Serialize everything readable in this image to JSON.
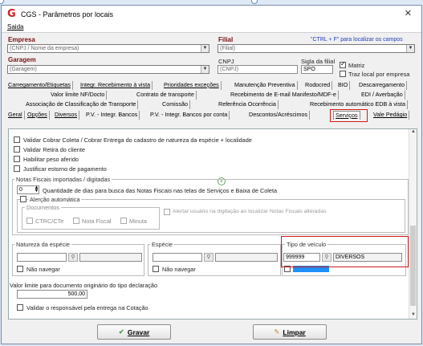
{
  "window": {
    "title": "CGS - Parâmetros por locais",
    "close": "✕",
    "app_icon": "G"
  },
  "menu": {
    "saida": "Saida"
  },
  "empresa": {
    "label": "Empresa",
    "value": "(CNPJ / Nome da empresa)"
  },
  "filial": {
    "label": "Filial",
    "value": "(Filial)",
    "hint": "\"CTRL + F\" para localizar os campos"
  },
  "garagem": {
    "label": "Garagem",
    "value": "(Garagem)"
  },
  "cnpj": {
    "label": "CNPJ",
    "value": "(CNPJ)"
  },
  "sigla": {
    "label": "Sigla da filial",
    "value": "SPO"
  },
  "matriz": {
    "label": "Matriz",
    "checked": true
  },
  "traz_local": {
    "label": "Traz local por empresa",
    "checked": false
  },
  "tabs_row1": [
    "Carregamento/Etiquetas",
    "Integr. Recebimento à vista",
    "Prioridades exceções",
    "Manutenção Preventiva",
    "Rodocred",
    "BIO",
    "Descarregamento"
  ],
  "tabs_row2": [
    "Valor limite NF/Docto",
    "Contrato de transporte",
    "Recebimento de E-mail Manifesto/MDF-e",
    "EDI / Averbação"
  ],
  "tabs_row3": [
    "Associação de Classificação de Transporte",
    "Comissão",
    "Referência Ocorrência",
    "Recebimento automático EDB à vista"
  ],
  "tabs_row4": [
    "Geral",
    "Opções",
    "Diversos",
    "P.V. - Integr. Bancos",
    "P.V. - Integr. Bancos por conta",
    "Descontos/Acréscimos",
    "Serviços",
    "Vale Pedágio"
  ],
  "options": {
    "cobrar_coleta": "Validar Cobrar Coleta / Cobrar Entrega do cadastro de natureza da espécie + localidade",
    "retira_cliente": "Validar Retira do cliente",
    "peso_aferido": "Habilitar peso aferido",
    "estorno_pagamento": "Justificar estorno de pagamento"
  },
  "notas": {
    "title": "Notas Fiscais importadas / digitadas",
    "dias_value": "0",
    "dias_label": "Quantidade de dias para busca das Notas Fiscais nas telas de Serviços e Baixa de Coleta",
    "alerta_auto": "Alerção automática",
    "documentos": "Documentos",
    "ctrc": "CTRC/CTe",
    "nota_fiscal": "Nota Fiscal",
    "minuta": "Minuta",
    "alertar": "Alertar usuário na digitação ao localizar Notas Fiscais alteradas"
  },
  "natureza": {
    "title": "Natureza da espécie",
    "nao_navegar": "Não navegar"
  },
  "especie": {
    "title": "Espécie",
    "nao_navegar": "Não navegar"
  },
  "tipo_veiculo": {
    "title": "Tipo de veículo",
    "code": "999999",
    "desc": "DIVERSOS"
  },
  "valor_limite": {
    "label": "Valor limite para documento originário do tipo declaração",
    "value": "500,00"
  },
  "validar_responsavel": "Validar o responsável pela entrega na Cotação",
  "buttons": {
    "gravar": "Gravar",
    "limpar": "Limpar"
  }
}
